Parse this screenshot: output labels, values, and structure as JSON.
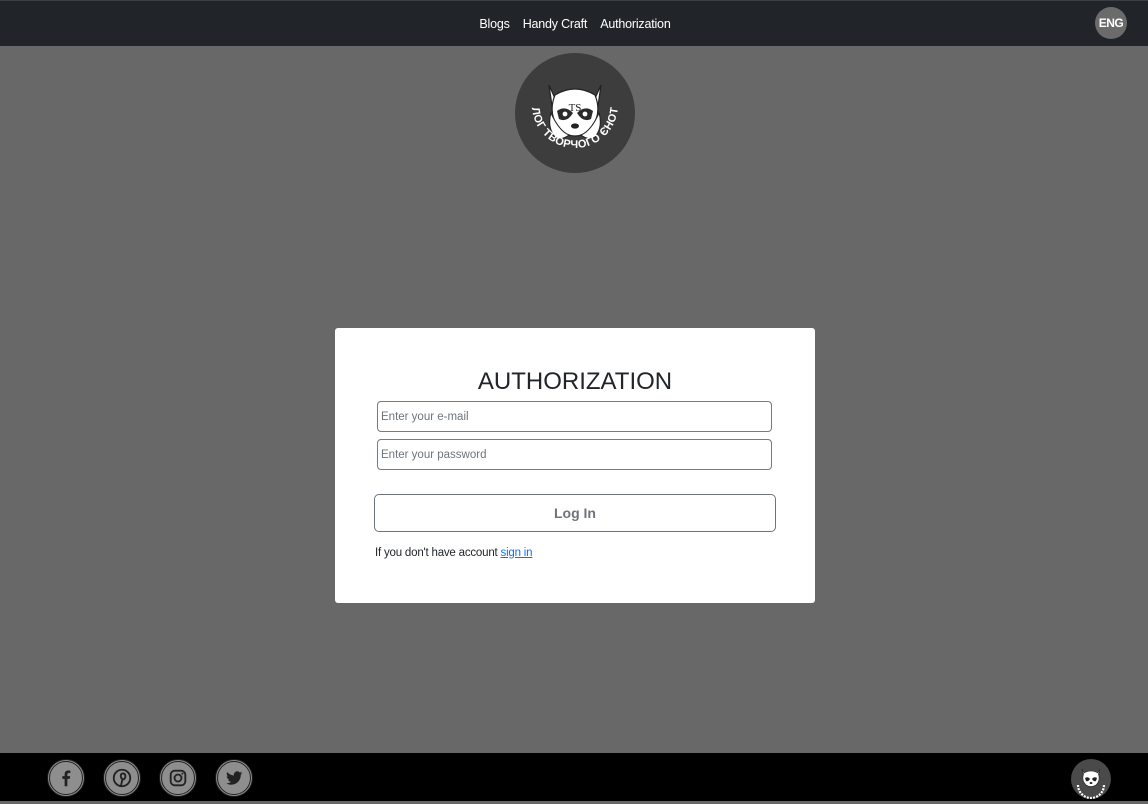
{
  "nav": {
    "items": [
      {
        "label": "Blogs"
      },
      {
        "label": "Handy Craft"
      },
      {
        "label": "Authorization"
      }
    ],
    "lang": "ENG"
  },
  "logo": {
    "initials": "TS",
    "ring_text": "\"БЛОГ ТВОРЧОГО ЄНОТА\"",
    "icon": "raccoon-logo-icon"
  },
  "auth": {
    "title": "AUTHORIZATION",
    "email_placeholder": "Enter your e-mail",
    "password_placeholder": "Enter your password",
    "login_label": "Log In",
    "no_account_text": "If you don't have account",
    "signin_link": "sign in"
  },
  "footer": {
    "social": [
      "facebook-icon",
      "pinterest-icon",
      "instagram-icon",
      "twitter-icon"
    ]
  },
  "colors": {
    "page_bg": "#686868",
    "nav_bg": "#212529",
    "footer_bg": "#000000",
    "card_bg": "#ffffff",
    "link": "#0d6efd",
    "button_text": "#6c757d"
  }
}
